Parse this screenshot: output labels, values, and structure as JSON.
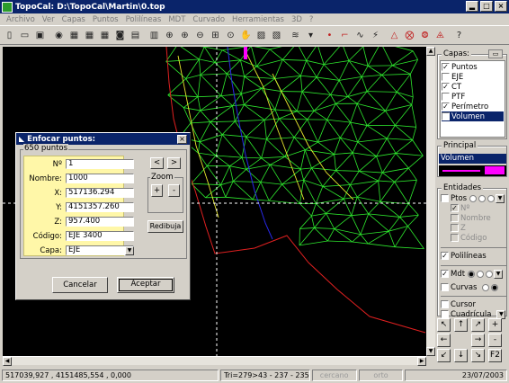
{
  "window": {
    "title": "TopoCal: D:\\TopoCal\\Martin\\0.top",
    "min": "▂",
    "max": "□",
    "close": "×"
  },
  "menu": [
    "Archivo",
    "Ver",
    "Capas",
    "Puntos",
    "Polilíneas",
    "MDT",
    "Curvado",
    "Herramientas",
    "3D",
    "?"
  ],
  "toolbar": [
    "new-icon",
    "open-icon",
    "save-icon",
    "help-icon",
    "points-icon",
    "points2-icon",
    "points3-icon",
    "export-icon",
    "print-icon",
    "preview-icon",
    "zoom-icon",
    "zoom-in-icon",
    "zoom-out-icon",
    "zoom-window-icon",
    "zoom-previous-icon",
    "pan-icon",
    "mdt-icon",
    "mdt2-icon",
    "layers-icon",
    "layers-dropdown-icon",
    "point-icon",
    "polyline-icon",
    "curves-icon",
    "break-icon",
    "triangle-icon",
    "triangle2-icon",
    "triangle3-icon",
    "triangle4-icon",
    "help2-icon"
  ],
  "status": {
    "coords": "517039,927 , 4151485,554 , 0,000",
    "tri": "Tri=279>43 - 237 - 235",
    "cercano": "cercano",
    "orto": "orto",
    "date": "23/07/2003"
  },
  "capas": {
    "title": "Capas:",
    "items": [
      {
        "label": "Puntos",
        "checked": true
      },
      {
        "label": "EJE",
        "checked": false
      },
      {
        "label": "CT",
        "checked": true
      },
      {
        "label": "PTF",
        "checked": false
      },
      {
        "label": "Perímetro",
        "checked": true
      },
      {
        "label": "Volumen",
        "checked": true,
        "selected": true
      }
    ]
  },
  "principal": {
    "title": "Principal",
    "layer": "Volumen"
  },
  "entidades": {
    "title": "Entidades",
    "ptos": "Ptos",
    "sub": [
      "Nº",
      "Nombre",
      "Z",
      "Código"
    ],
    "polilineas": "Polilíneas",
    "mdt": "Mdt",
    "curvas": "Curvas",
    "cursor": "Cursor",
    "cuadricula": "Cuadrícula"
  },
  "nav": [
    "↖",
    "↑",
    "↗",
    "+",
    "←",
    "",
    "→",
    "-",
    "↙",
    "↓",
    "↘",
    "F2"
  ],
  "dialog": {
    "title": "Enfocar puntos:",
    "count": "650 puntos",
    "labels": {
      "num": "Nº",
      "nombre": "Nombre:",
      "x": "X:",
      "y": "Y:",
      "z": "Z:",
      "codigo": "Código:",
      "capa": "Capa:"
    },
    "values": {
      "num": "1",
      "nombre": "1000",
      "x": "517136.294",
      "y": "4151357.260",
      "z": "957.400",
      "codigo": "EJE 3400",
      "capa": "EJE"
    },
    "zoom": "Zoom",
    "zoom_in": "+",
    "zoom_out": "-",
    "redibuja": "Redibuja",
    "prev": "<",
    "next": ">",
    "cancel": "Cancelar",
    "accept": "Aceptar"
  },
  "colors": {
    "bg": "#000000",
    "mesh": "#2ee82e",
    "curves": "#e8e82e",
    "perimeter": "#e02020",
    "axis": "#2828e8",
    "volumen": "#ff00ff"
  }
}
